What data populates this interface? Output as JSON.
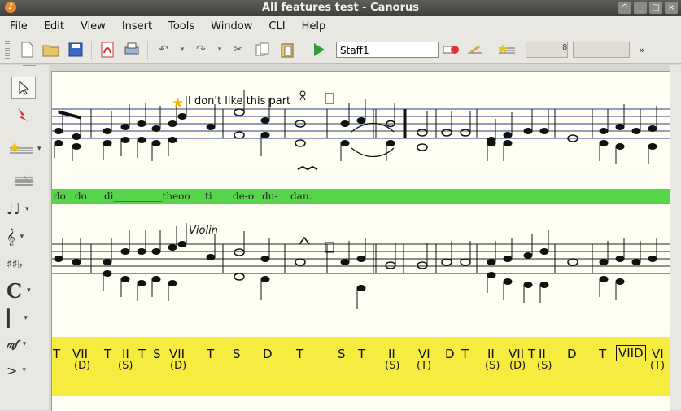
{
  "window": {
    "title": "All features test - Canorus",
    "buttons": [
      "^",
      "_",
      "□",
      "×"
    ]
  },
  "menu": [
    "File",
    "Edit",
    "View",
    "Insert",
    "Tools",
    "Window",
    "CLI",
    "Help"
  ],
  "toolbar": {
    "staff_select": "Staff1"
  },
  "score": {
    "staff1_text": "I don't like this part",
    "staff2_text": "Violin",
    "lyrics": [
      "do",
      "do",
      "di__________theoo",
      "ti",
      "de-o",
      "du-",
      "dan."
    ],
    "function_marks": [
      {
        "main": "T"
      },
      {
        "main": "VII",
        "sub": "(D)"
      },
      {
        "main": "T"
      },
      {
        "main": "II",
        "sub": "(S)"
      },
      {
        "main": "T"
      },
      {
        "main": "S"
      },
      {
        "main": "VII",
        "sub": "(D)"
      },
      {
        "main": "T"
      },
      {
        "main": "S"
      },
      {
        "main": "D"
      },
      {
        "main": "T"
      },
      {
        "main": "S"
      },
      {
        "main": "T"
      },
      {
        "main": "II",
        "sub": "(S)"
      },
      {
        "main": "VI",
        "sub": "(T)"
      },
      {
        "main": "D"
      },
      {
        "main": "T"
      },
      {
        "main": "II",
        "sub": "(S)"
      },
      {
        "main": "VII",
        "sub": "(D)"
      },
      {
        "main": "T"
      },
      {
        "main": "II",
        "sub": "(S)"
      },
      {
        "main": "D"
      },
      {
        "main": "T"
      },
      {
        "main": "VIID",
        "boxed": true
      },
      {
        "main": "VI",
        "sub": "(T)"
      }
    ]
  },
  "colors": {
    "lyrics_bg": "#57d54a",
    "functions_bg": "#f5ec3f",
    "staff_line": "#2a3b8f",
    "score_bg": "#fffef2"
  }
}
